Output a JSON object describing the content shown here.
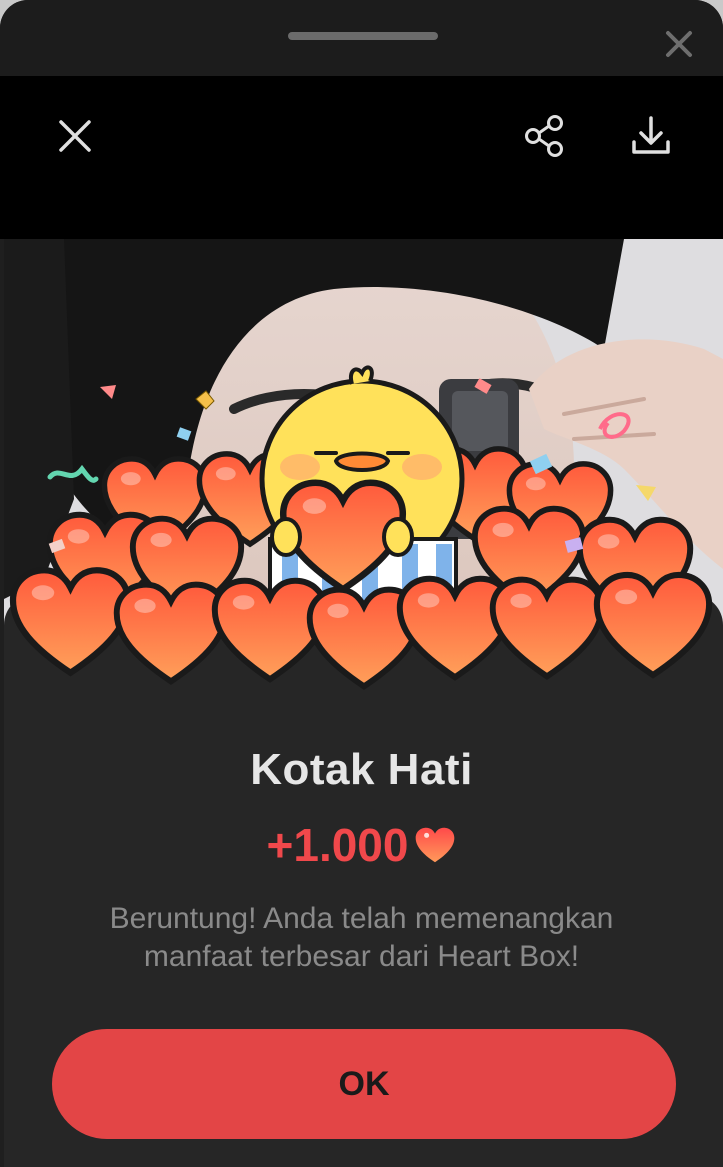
{
  "sheet": {
    "close_icon": "close-icon"
  },
  "viewer_toolbar": {
    "close_icon": "close-icon",
    "share_icon": "share-icon",
    "download_icon": "download-icon"
  },
  "reward_card": {
    "title": "Kotak Hati",
    "amount": "+1.000",
    "amount_icon": "heart-icon",
    "message": "Beruntung! Anda telah memenangkan manfaat terbesar dari Heart Box!",
    "ok_label": "OK"
  },
  "colors": {
    "accent": "#e34546",
    "amount_text": "#f0484b",
    "background": "#1f1f1f",
    "card": "#262626"
  }
}
